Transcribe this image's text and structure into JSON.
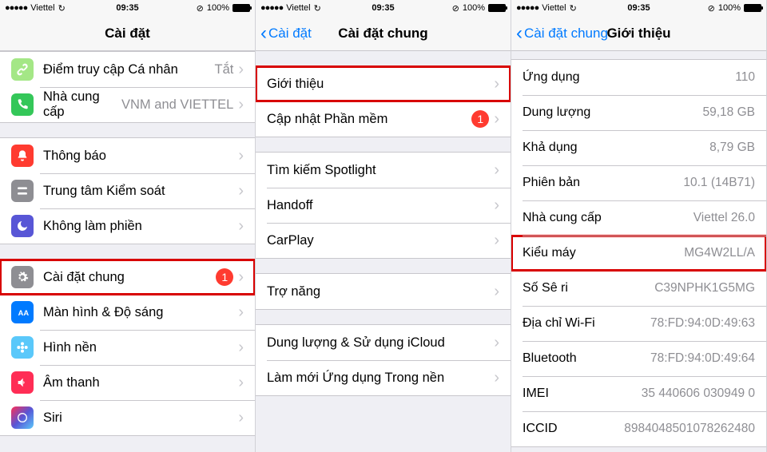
{
  "status": {
    "carrier": "Viettel",
    "time": "09:35",
    "battery_pct": "100%",
    "sync_icon": "↻"
  },
  "chevron_right": "›",
  "chevron_left": "‹",
  "panel1": {
    "title": "Cài đặt",
    "group1": [
      {
        "name": "personal-hotspot",
        "label": "Điểm truy cập Cá nhân",
        "value": "Tắt",
        "icon": "chain",
        "color": "ic-lightgreen"
      },
      {
        "name": "carrier",
        "label": "Nhà cung cấp",
        "value": "VNM and VIETTEL",
        "icon": "phone",
        "color": "ic-green2"
      }
    ],
    "group2": [
      {
        "name": "notifications",
        "label": "Thông báo",
        "icon": "bell",
        "color": "ic-red"
      },
      {
        "name": "control-center",
        "label": "Trung tâm Kiểm soát",
        "icon": "switches",
        "color": "ic-gray"
      },
      {
        "name": "do-not-disturb",
        "label": "Không làm phiền",
        "icon": "moon",
        "color": "ic-purple"
      }
    ],
    "group3": [
      {
        "name": "general",
        "label": "Cài đặt chung",
        "icon": "gear",
        "color": "ic-gray",
        "badge": "1",
        "highlight": true
      },
      {
        "name": "display",
        "label": "Màn hình & Độ sáng",
        "icon": "aa",
        "color": "ic-blue"
      },
      {
        "name": "wallpaper",
        "label": "Hình nền",
        "icon": "flower",
        "color": "ic-cyan"
      },
      {
        "name": "sounds",
        "label": "Âm thanh",
        "icon": "speaker",
        "color": "ic-pink"
      },
      {
        "name": "siri",
        "label": "Siri",
        "icon": "siri",
        "color": "ic-multi"
      }
    ]
  },
  "panel2": {
    "back": "Cài đặt",
    "title": "Cài đặt chung",
    "group1": [
      {
        "name": "about",
        "label": "Giới thiệu",
        "highlight": true
      },
      {
        "name": "software-update",
        "label": "Cập nhật Phần mềm",
        "badge": "1"
      }
    ],
    "group2": [
      {
        "name": "spotlight",
        "label": "Tìm kiếm Spotlight"
      },
      {
        "name": "handoff",
        "label": "Handoff"
      },
      {
        "name": "carplay",
        "label": "CarPlay"
      }
    ],
    "group3": [
      {
        "name": "accessibility",
        "label": "Trợ năng"
      }
    ],
    "group4": [
      {
        "name": "storage-icloud",
        "label": "Dung lượng & Sử dụng iCloud"
      },
      {
        "name": "background-app-refresh",
        "label": "Làm mới Ứng dụng Trong nền"
      }
    ]
  },
  "panel3": {
    "back": "Cài đặt chung",
    "title": "Giới thiệu",
    "rows": [
      {
        "name": "applications",
        "label": "Ứng dụng",
        "value": "110"
      },
      {
        "name": "capacity",
        "label": "Dung lượng",
        "value": "59,18 GB"
      },
      {
        "name": "available",
        "label": "Khả dụng",
        "value": "8,79 GB"
      },
      {
        "name": "version",
        "label": "Phiên bản",
        "value": "10.1 (14B71)"
      },
      {
        "name": "carrier",
        "label": "Nhà cung cấp",
        "value": "Viettel 26.0"
      },
      {
        "name": "model",
        "label": "Kiểu máy",
        "value": "MG4W2LL/A",
        "highlight": true
      },
      {
        "name": "serial-number",
        "label": "Số Sê ri",
        "value": "C39NPHK1G5MG"
      },
      {
        "name": "wifi-address",
        "label": "Địa chỉ Wi-Fi",
        "value": "78:FD:94:0D:49:63"
      },
      {
        "name": "bluetooth",
        "label": "Bluetooth",
        "value": "78:FD:94:0D:49:64"
      },
      {
        "name": "imei",
        "label": "IMEI",
        "value": "35 440606 030949 0"
      },
      {
        "name": "iccid",
        "label": "ICCID",
        "value": "8984048501078262480"
      }
    ]
  }
}
